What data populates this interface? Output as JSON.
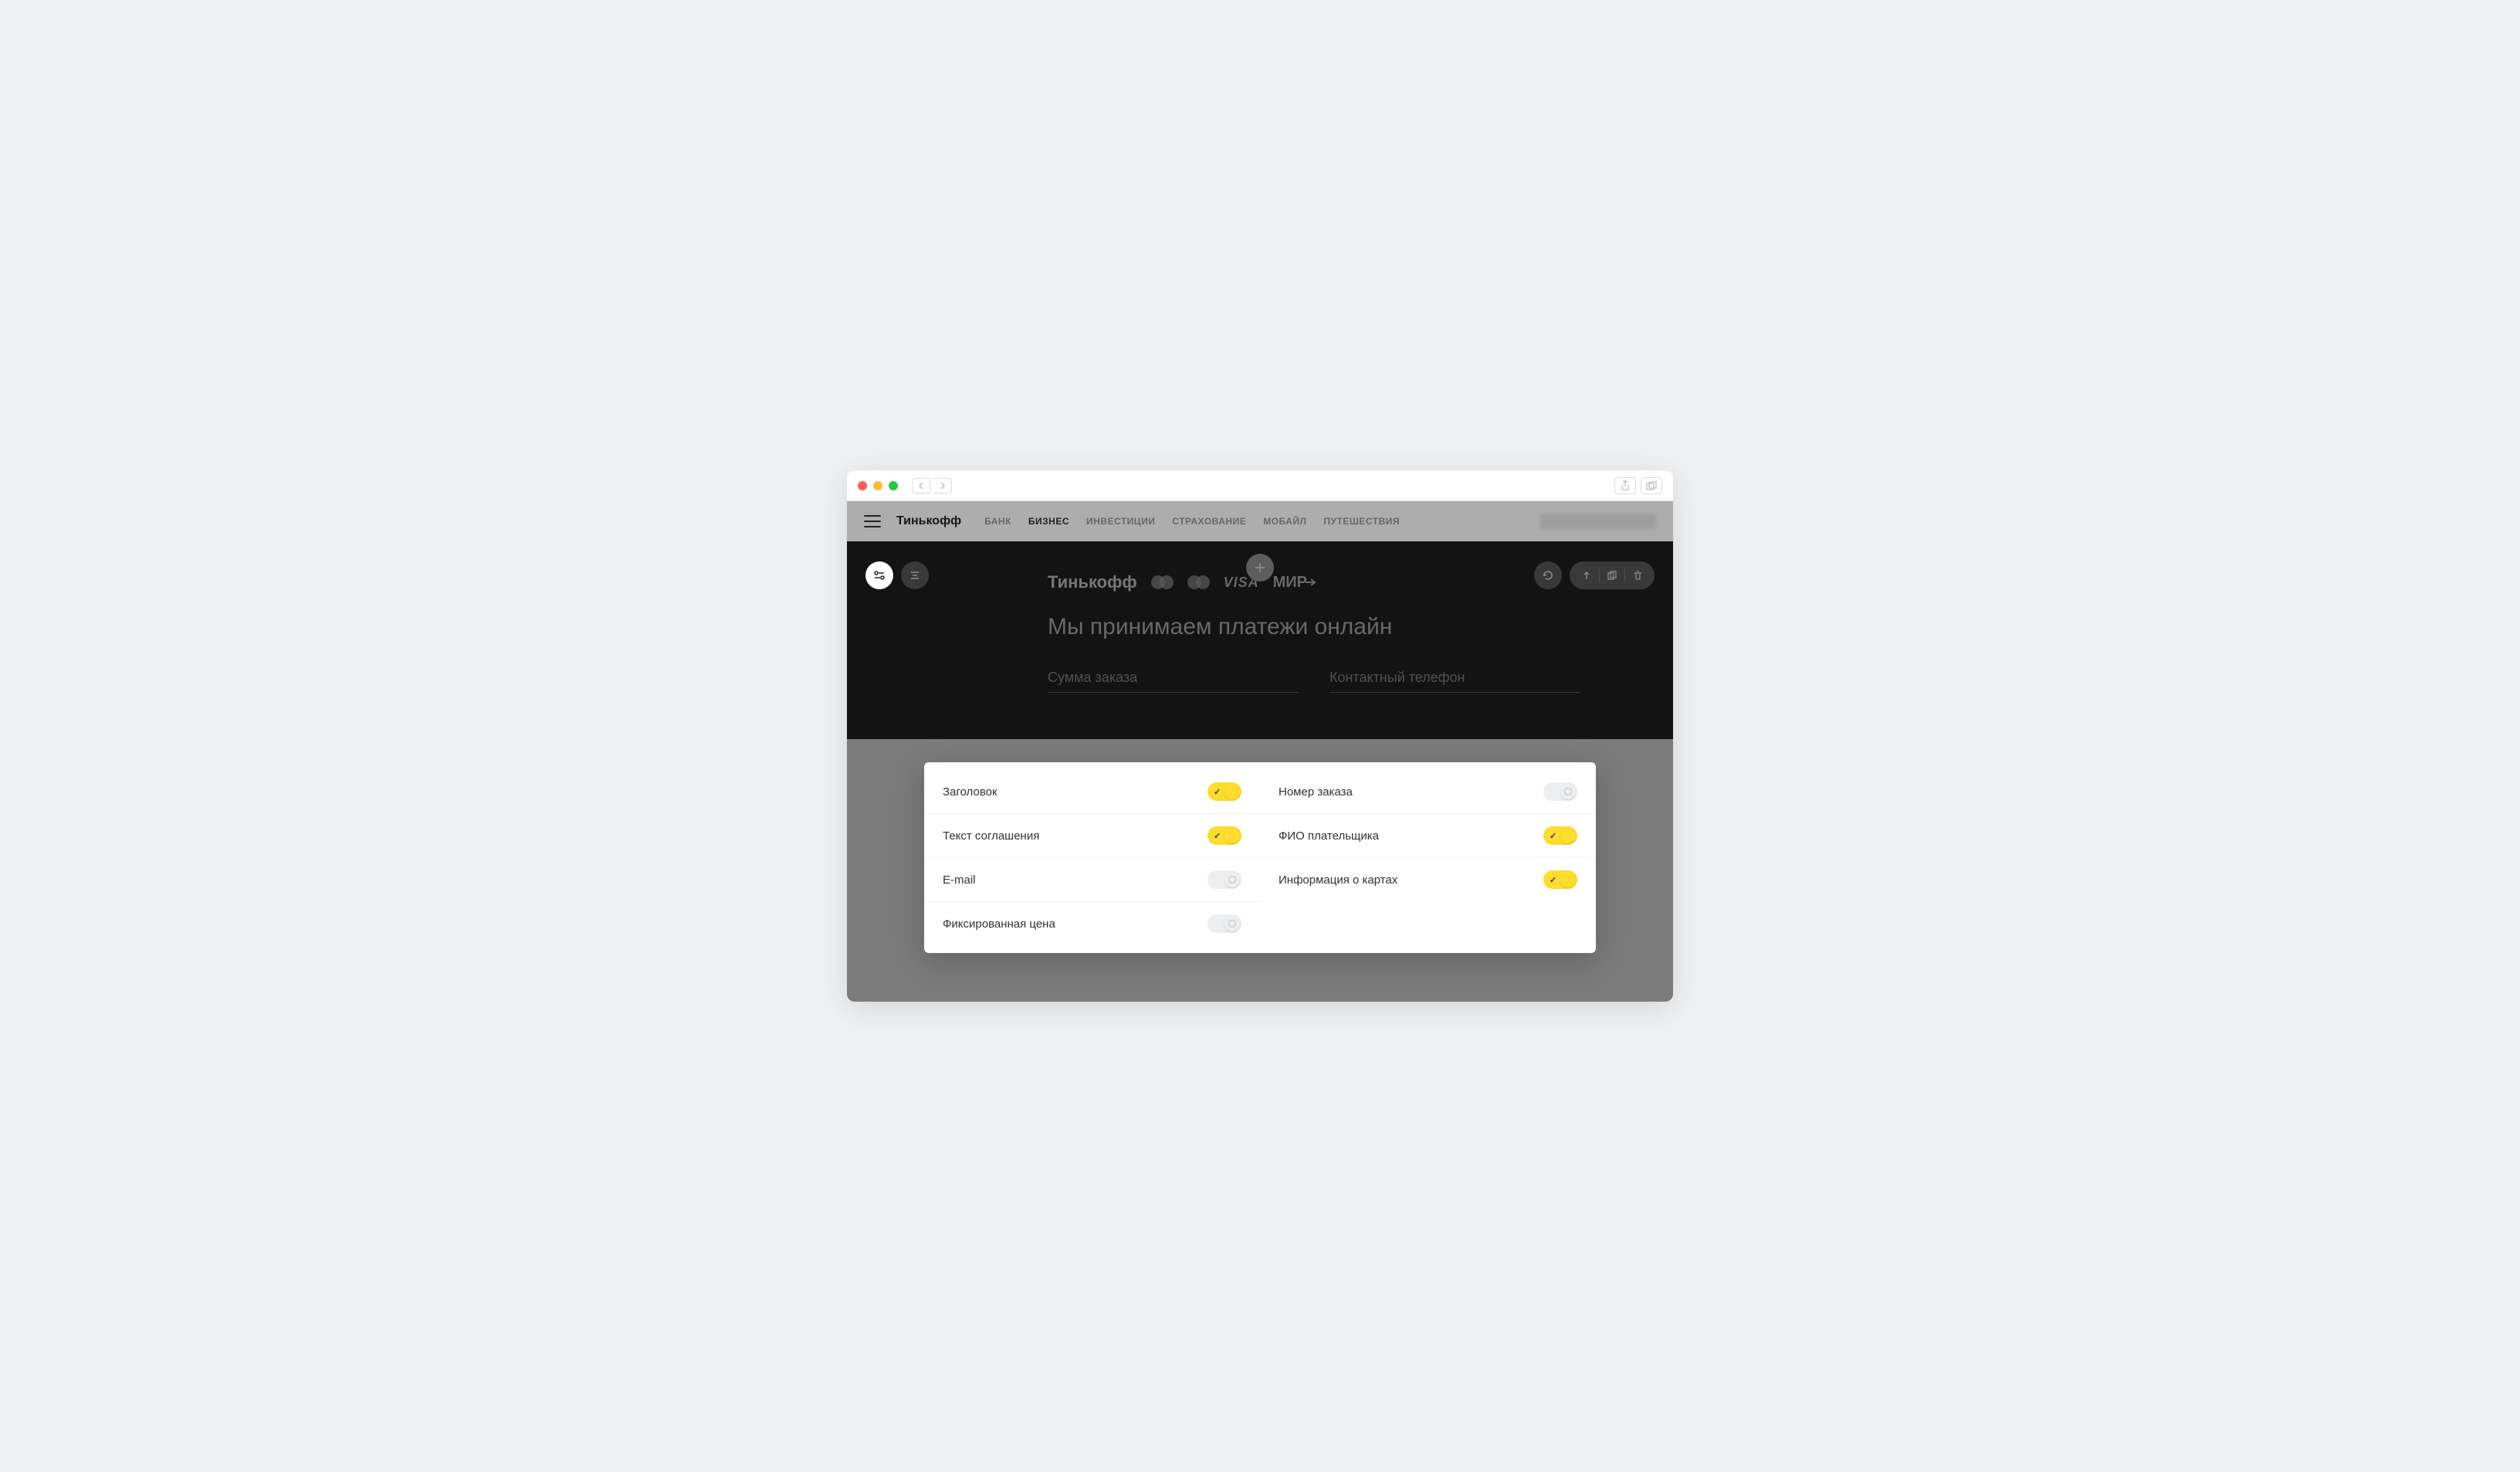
{
  "nav": {
    "brand": "Тинькофф",
    "links": [
      "БАНК",
      "БИЗНЕС",
      "ИНВЕСТИЦИИ",
      "СТРАХОВАНИЕ",
      "МОБАЙЛ",
      "ПУТЕШЕСТВИЯ"
    ],
    "active_index": 1
  },
  "dark": {
    "brand": "Тинькофф",
    "pay_systems": [
      "mastercard",
      "maestro",
      "visa",
      "mir"
    ],
    "headline": "Мы принимаем платежи онлайн",
    "input1_placeholder": "Сумма заказа",
    "input2_placeholder": "Контактный телефон"
  },
  "settings": {
    "left": [
      {
        "label": "Заголовок",
        "on": true
      },
      {
        "label": "Текст соглашения",
        "on": true
      },
      {
        "label": "E-mail",
        "on": false
      },
      {
        "label": "Фиксированная цена",
        "on": false
      }
    ],
    "right": [
      {
        "label": "Номер заказа",
        "on": false
      },
      {
        "label": "ФИО плательщика",
        "on": true
      },
      {
        "label": "Информация о картах",
        "on": true
      }
    ]
  }
}
